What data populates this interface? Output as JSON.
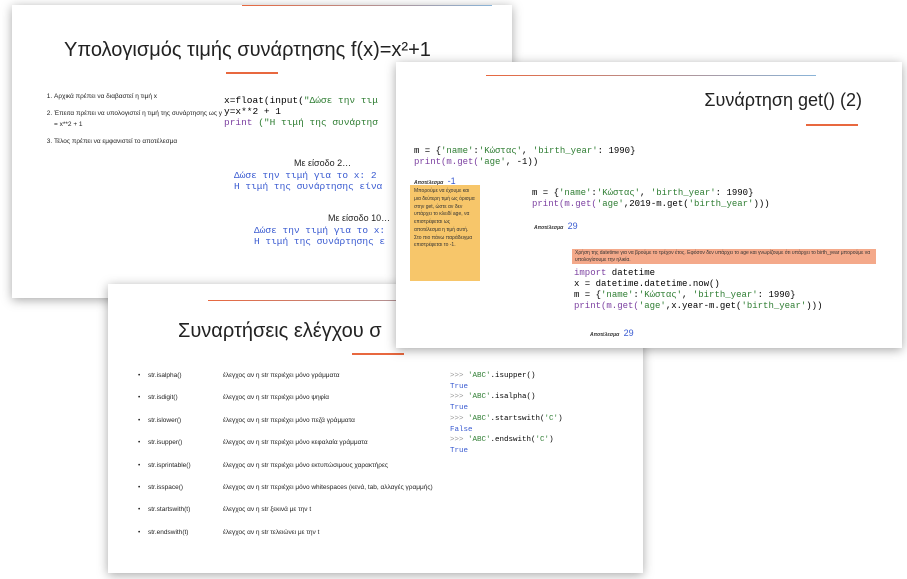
{
  "slide1": {
    "title": "Υπολογισμός τιμής συνάρτησης f(x)=x²+1",
    "list_items": [
      "Αρχικά πρέπει να διαβαστεί η τιμή x",
      "Έπειτα πρέπει να υπολογιστεί η τιμή της συνάρτησης ως y = x**2 + 1",
      "Τέλος πρέπει να εμφανιστεί το αποτέλεσμα"
    ],
    "code_line1_a": "x=float(input(",
    "code_line1_b": "\"Δώσε την τιμ",
    "code_line2": "y=x**2 + 1",
    "code_line3_a": "print",
    "code_line3_b": " (\"Η τιμή της συνάρτησ",
    "example1_heading": "Με είσοδο 2…",
    "example1_line1": "Δώσε την τιμή για το x: 2",
    "example1_line2": "Η τιμή της συνάρτησης είνα",
    "example2_heading": "Με είσοδο 10…",
    "example2_line1": "Δώσε την τιμή για το x:",
    "example2_line2": "Η τιμή της συνάρτησης ε"
  },
  "slide2": {
    "title": "Συναρτήσεις ελέγχου σ",
    "functions": [
      {
        "name": "str.isalpha()",
        "desc": "έλεγχος αν η str περιέχει μόνο γράμματα"
      },
      {
        "name": "str.isdigit()",
        "desc": "έλεγχος αν η str περιέχει μόνο ψηφία"
      },
      {
        "name": "str.islower()",
        "desc": "έλεγχος αν η str περιέχει μόνο πεζά γράμματα"
      },
      {
        "name": "str.isupper()",
        "desc": "έλεγχος αν η str περιέχει μόνο κεφαλαία γράμματα"
      },
      {
        "name": "str.isprintable()",
        "desc": "έλεγχος αν η str περιέχει μόνο εκτυπώσιμους χαρακτήρες"
      },
      {
        "name": "str.isspace()",
        "desc": "έλεγχος αν η str περιέχει μόνο whitespaces (κενά, tab, αλλαγές γραμμής)"
      },
      {
        "name": "str.startswith(t)",
        "desc": "έλεγχος αν η str ξεκινά με την t"
      },
      {
        "name": "str.endswith(t)",
        "desc": "έλεγχος αν η str τελειώνει με την t"
      }
    ],
    "examples": [
      {
        "prompt": ">>> ",
        "arg": "'ABC'",
        "call": ".isupper()",
        "result": "True"
      },
      {
        "prompt": ">>> ",
        "arg": "'ABC'",
        "call": ".isalpha()",
        "result": "True"
      },
      {
        "prompt": ">>> ",
        "arg": "'ABC'",
        "call": ".startswith(",
        "arg2": "'C'",
        "close": ")",
        "result": "False"
      },
      {
        "prompt": ">>> ",
        "arg": "'ABC'",
        "call": ".endswith(",
        "arg2": "'C'",
        "close": ")",
        "result": "True"
      }
    ]
  },
  "slide3": {
    "title": "Συνάρτηση get() (2)",
    "code1_line1_a": "m = {",
    "code1_line1_b": "'name'",
    "code1_line1_c": ":",
    "code1_line1_d": "'Κώστας'",
    "code1_line1_e": ", ",
    "code1_line1_f": "'birth_year'",
    "code1_line1_g": ": 1990}",
    "code1_line2_a": "print(m.get(",
    "code1_line2_b": "'age'",
    "code1_line2_c": ", -1))",
    "result_label": "Αποτέλεσμα",
    "result1": "-1",
    "yellow_note": "Μπορούμε να έχουμε και μια δεύτερη τιμή ως όρισμα στην get, ώστε αν δεν υπάρχει το κλειδί age, να επιστρέφεται ως αποτέλεσμα η τιμή αυτή. Στο πιο πάνω παράδειγμα επιστρέφεται το -1.",
    "code2_line1_a": "m = {",
    "code2_line1_b": "'name'",
    "code2_line1_c": ":",
    "code2_line1_d": "'Κώστας'",
    "code2_line1_e": ", ",
    "code2_line1_f": "'birth_year'",
    "code2_line1_g": ": 1990}",
    "code2_line2_a": "print(m.get(",
    "code2_line2_b": "'age'",
    "code2_line2_c": ",2019-m.get(",
    "code2_line2_d": "'birth_year'",
    "code2_line2_e": ")))",
    "result2": "29",
    "orange_note": "Χρήση της datetime για να βρούμε το τρέχον έτος. Εφόσον δεν υπάρχει το age και γνωρίζουμε ότι υπάρχει το birth_year μπορούμε να υπολογίσουμε την ηλικία.",
    "code3_line1_a": "import",
    "code3_line1_b": " datetime",
    "code3_line2": "x = datetime.datetime.now()",
    "code3_line3_a": "m = {",
    "code3_line3_b": "'name'",
    "code3_line3_c": ":",
    "code3_line3_d": "'Κώστας'",
    "code3_line3_e": ", ",
    "code3_line3_f": "'birth_year'",
    "code3_line3_g": ": 1990}",
    "code3_line4_a": "print(m.get(",
    "code3_line4_b": "'age'",
    "code3_line4_c": ",x.year-m.get(",
    "code3_line4_d": "'birth_year'",
    "code3_line4_e": ")))",
    "result3": "29"
  },
  "colors": {
    "accent": "#e8683f",
    "keyword": "#7b3fa0",
    "string": "#2e7d32",
    "output": "#3a5bd1",
    "note_yellow": "#f7c66a",
    "note_orange": "#f4a98a"
  }
}
